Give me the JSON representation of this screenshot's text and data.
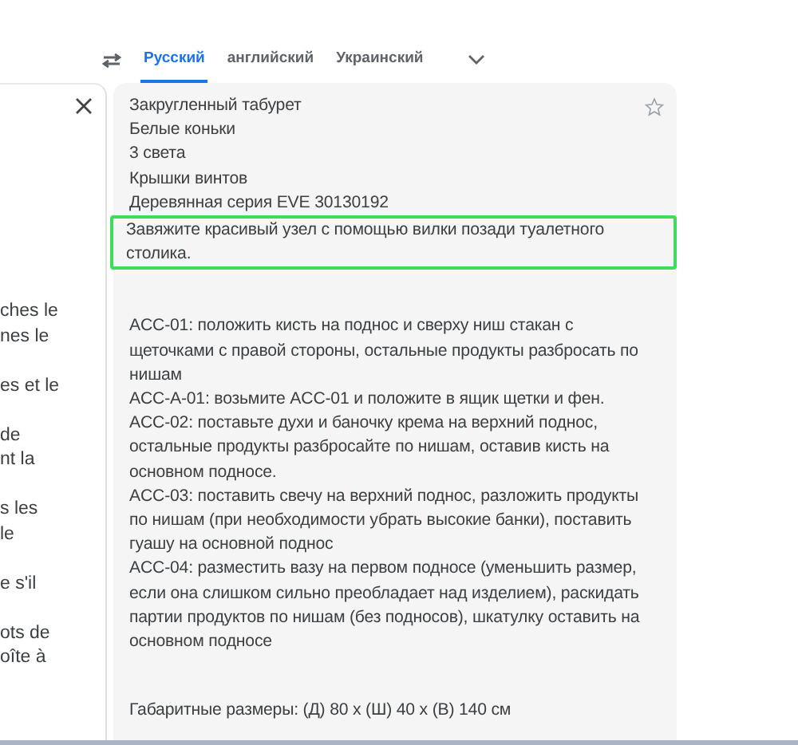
{
  "source_panel": {
    "lines": [
      "ches le",
      "nes le",
      "es et le",
      "de",
      "nt la",
      "s les",
      "le",
      "e s'il",
      "ots de",
      "oîte à"
    ]
  },
  "language_tabs": [
    {
      "label": "Русский",
      "selected": true
    },
    {
      "label": "английский",
      "selected": false
    },
    {
      "label": "Украинский",
      "selected": false
    }
  ],
  "translation": {
    "sections": [
      {
        "paragraphs": [
          {
            "text": "Закругленный табурет",
            "highlighted": false
          },
          {
            "text": "Белые коньки",
            "highlighted": false
          },
          {
            "text": "3 света",
            "highlighted": false
          },
          {
            "text": "Крышки винтов",
            "highlighted": false
          },
          {
            "text": "Деревянная серия EVE 30130192",
            "highlighted": false
          },
          {
            "text": "Завяжите красивый узел с помощью вилки позади туалетного столика.",
            "highlighted": true
          }
        ]
      },
      {
        "paragraphs": [
          {
            "text": "ACC-01: положить кисть на поднос и сверху ниш стакан с щеточками с правой стороны, остальные продукты разбросать по нишам",
            "highlighted": false
          },
          {
            "text": "ACC-A-01: возьмите ACC-01 и положите в ящик щетки и фен.",
            "highlighted": false
          },
          {
            "text": "ACC-02: поставьте духи и баночку крема на верхний поднос, остальные продукты разбросайте по нишам, оставив кисть на основном подносе.",
            "highlighted": false
          },
          {
            "text": "ACC-03: поставить свечу на верхний поднос, разложить продукты по нишам (при необходимости убрать высокие банки), поставить гуашу на основной поднос",
            "highlighted": false
          },
          {
            "text": "ACC-04: разместить вазу на первом подносе (уменьшить размер, если она слишком сильно преобладает над изделием), раскидать партии продуктов по нишам (без подносов), шкатулку оставить на основном подносе",
            "highlighted": false
          }
        ]
      },
      {
        "paragraphs": [
          {
            "text": "Габаритные размеры: (Д) 80 x (Ш) 40 x (В) 140 см",
            "highlighted": false
          }
        ]
      }
    ]
  }
}
